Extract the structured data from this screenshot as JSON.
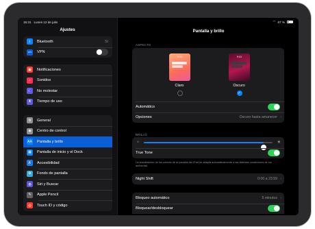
{
  "status": {
    "time": "15:31",
    "date": "Lunes 12 de julio",
    "battery": "67 %"
  },
  "sidebar": {
    "title": "Ajustes",
    "group1": [
      {
        "label": "Bluetooth",
        "icon": "bluetooth-icon",
        "glyph": "ᛒ",
        "color": "#0a84ff",
        "value": "Sí"
      },
      {
        "label": "VPN",
        "icon": "vpn-icon",
        "glyph": "VPN",
        "color": "#0a5fd6",
        "toggle": false
      }
    ],
    "group2": [
      {
        "label": "Notificaciones",
        "icon": "notifications-icon",
        "glyph": "▣",
        "color": "#ff3b30"
      },
      {
        "label": "Sonidos",
        "icon": "sounds-icon",
        "glyph": "♪",
        "color": "#ff2d55"
      },
      {
        "label": "No molestar",
        "icon": "moon-icon",
        "glyph": "☾",
        "color": "#5e5ce6"
      },
      {
        "label": "Tiempo de uso",
        "icon": "hourglass-icon",
        "glyph": "⧗",
        "color": "#5e5ce6"
      }
    ],
    "group3": [
      {
        "label": "General",
        "icon": "gear-icon",
        "glyph": "⚙",
        "color": "#8e8e93"
      },
      {
        "label": "Centro de control",
        "icon": "control-center-icon",
        "glyph": "◉",
        "color": "#8e8e93"
      },
      {
        "label": "Pantalla y brillo",
        "icon": "brightness-icon",
        "glyph": "AA",
        "color": "#0a84ff",
        "selected": true
      },
      {
        "label": "Pantalla de inicio y el Dock",
        "icon": "home-screen-icon",
        "glyph": "▦",
        "color": "#0a84ff"
      },
      {
        "label": "Accesibilidad",
        "icon": "accessibility-icon",
        "glyph": "♿",
        "color": "#0a84ff"
      },
      {
        "label": "Fondo de pantalla",
        "icon": "wallpaper-icon",
        "glyph": "✿",
        "color": "#34aadc"
      },
      {
        "label": "Siri y Buscar",
        "icon": "siri-icon",
        "glyph": "◍",
        "color": "#5856d6"
      },
      {
        "label": "Apple Pencil",
        "icon": "pencil-icon",
        "glyph": "✎",
        "color": "#636366"
      },
      {
        "label": "Touch ID y código",
        "icon": "fingerprint-icon",
        "glyph": "◎",
        "color": "#ff3b30"
      }
    ]
  },
  "main": {
    "title": "Pantalla y brillo",
    "appearance": {
      "header": "ASPECTO",
      "light": {
        "label": "Claro",
        "time": "9:41"
      },
      "dark": {
        "label": "Oscuro",
        "time": "9:41"
      },
      "selected": "dark",
      "automatic_label": "Automático",
      "automatic": true,
      "options_label": "Opciones",
      "options_value": "Oscuro hasta amanecer"
    },
    "brightness": {
      "header": "BRILLO",
      "level": 0.93,
      "true_tone_label": "True Tone",
      "true_tone": true,
      "note": "La visualización de los colores de la pantalla del iPad se adapta automáticamente a las distintas condiciones de luz ambiental."
    },
    "night_shift": {
      "label": "Night Shift",
      "value": "0:00 a 23:59"
    },
    "lock": {
      "auto_lock_label": "Bloqueo automático",
      "auto_lock_value": "5 minutos",
      "lock_unlock_label": "Bloquear/desbloquear",
      "lock_unlock": true
    }
  }
}
